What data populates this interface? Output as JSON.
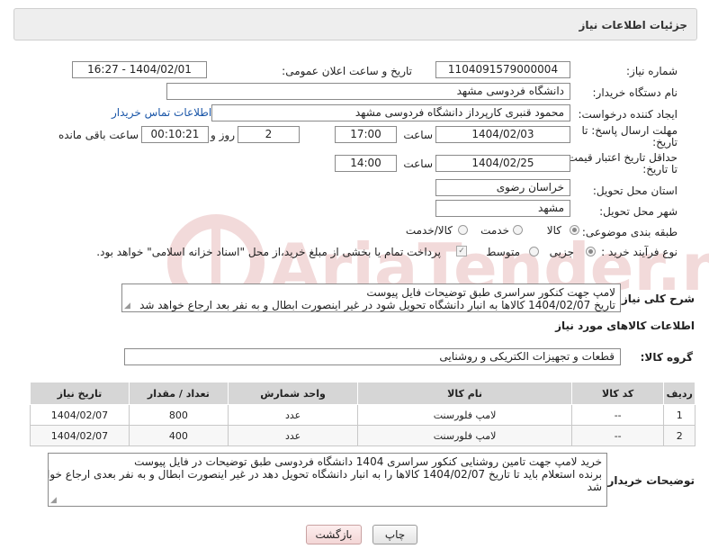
{
  "header": {
    "title": "جزئیات اطلاعات نیاز"
  },
  "fields": {
    "need_number_label": "شماره نیاز:",
    "need_number": "1104091579000004",
    "announce_label": "تاریخ و ساعت اعلان عمومی:",
    "announce_value": "1404/02/01 - 16:27",
    "buyer_org_label": "نام دستگاه خریدار:",
    "buyer_org": "دانشگاه فردوسی مشهد",
    "creator_label": "ایجاد کننده درخواست:",
    "creator": "محمود قنبری کارپرداز دانشگاه فردوسی مشهد",
    "buyer_contact_link": "اطلاعات تماس خریدار",
    "deadline_label_1": "مهلت ارسال پاسخ: تا",
    "deadline_label_2": "تاریخ:",
    "deadline_date": "1404/02/03",
    "time_label": "ساعت",
    "deadline_time": "17:00",
    "days_value": "2",
    "days_label": "روز و",
    "remaining_time": "00:10:21",
    "remaining_label": "ساعت باقی مانده",
    "min_validity_label_1": "حداقل تاریخ اعتبار قیمت:",
    "min_validity_label_2": "تا تاریخ:",
    "validity_date": "1404/02/25",
    "validity_time": "14:00",
    "province_label": "استان محل تحویل:",
    "province": "خراسان رضوی",
    "city_label": "شهر محل تحویل:",
    "city": "مشهد",
    "category_label": "طبقه بندی موضوعی:",
    "category_options": [
      "کالا",
      "خدمت",
      "کالا/خدمت"
    ],
    "category_selected": "کالا",
    "process_label": "نوع فرآیند خرید :",
    "process_options": [
      "جزیی",
      "متوسط"
    ],
    "process_selected": "جزیی",
    "payment_note": "پرداخت تمام یا بخشی از مبلغ خرید،از محل \"اسناد خزانه اسلامی\" خواهد بود."
  },
  "description": {
    "label": "شرح کلی نیاز:",
    "line1": "لامپ جهت کنکور سراسری طبق توضیحات فایل پیوست",
    "line2": "تاریخ 1404/02/07 کالاها به انبار دانشگاه تحویل شود در غیر اینصورت ابطال و به نفر بعد ارجاع خواهد شد"
  },
  "goods": {
    "section_title": "اطلاعات کالاهای مورد نیاز",
    "group_label": "گروه کالا:",
    "group_value": "قطعات و تجهیزات الکتریکی و روشنایی",
    "columns": [
      "ردیف",
      "کد کالا",
      "نام کالا",
      "واحد شمارش",
      "تعداد / مقدار",
      "تاریخ نیاز"
    ],
    "rows": [
      [
        "1",
        "--",
        "لامپ فلورسنت",
        "عدد",
        "800",
        "1404/02/07"
      ],
      [
        "2",
        "--",
        "لامپ فلورسنت",
        "عدد",
        "400",
        "1404/02/07"
      ]
    ]
  },
  "buyer_notes": {
    "label": "توضیحات خریدار:",
    "line1": "خرید لامپ جهت تامین روشنایی کنکور سراسری 1404 دانشگاه فردوسی طبق توضیحات در فایل پیوست",
    "line2": "برنده استعلام باید تا تاریخ 1404/02/07 کالاها را به انبار دانشگاه تحویل دهد در غیر اینصورت ابطال و به نفر بعدی ارجاع خواهد",
    "line3": "شد"
  },
  "buttons": {
    "print": "چاپ",
    "back": "بازگشت"
  },
  "watermark": {
    "text": "AriaTender.neT"
  },
  "colors": {
    "link": "#1a56a8",
    "panel_bg": "#eeeeee",
    "table_header": "#d6d6d6",
    "back_button": "#f3d6d6",
    "watermark": "#b22222"
  }
}
